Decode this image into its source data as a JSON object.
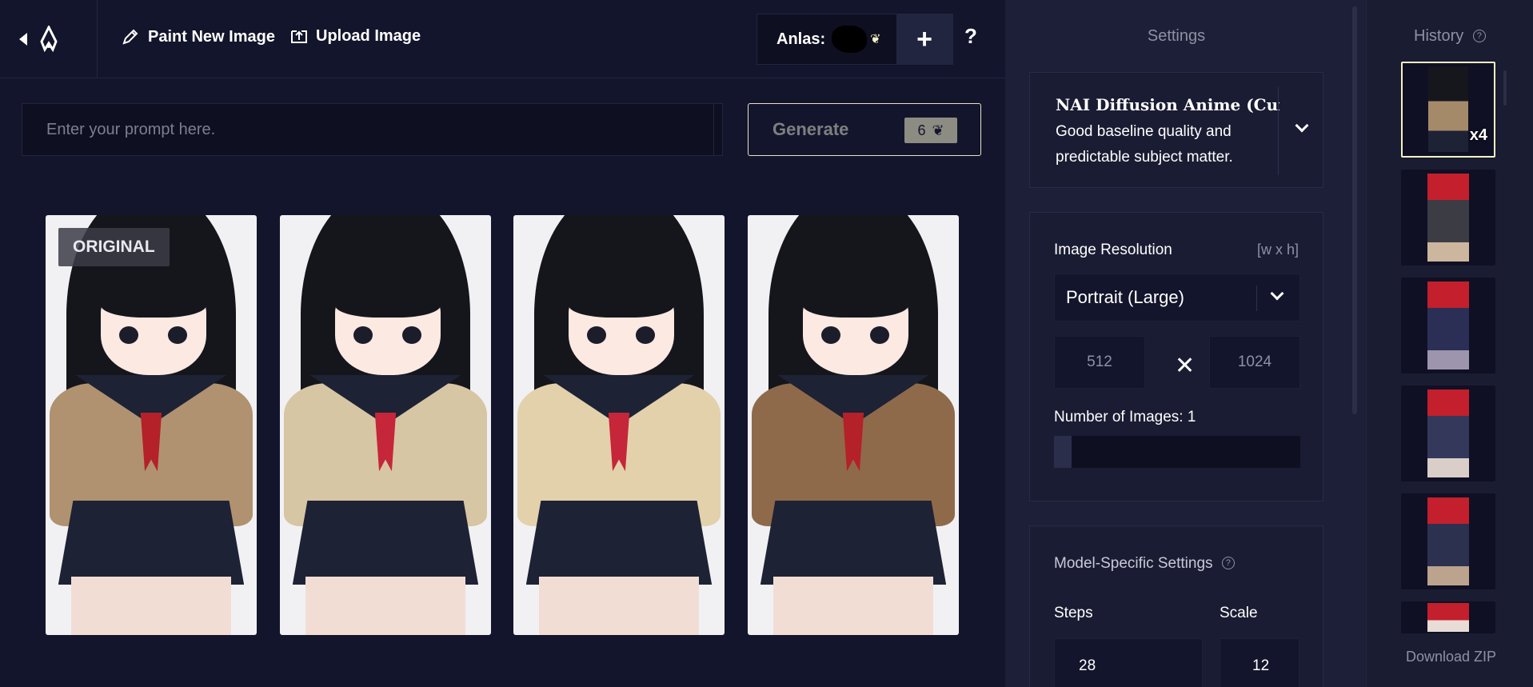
{
  "topbar": {
    "paint_label": "Paint New Image",
    "upload_label": "Upload Image",
    "anlas_label": "Anlas:",
    "plus_label": "+",
    "help_label": "?"
  },
  "prompt": {
    "placeholder": "Enter your prompt here.",
    "value": ""
  },
  "generate": {
    "label": "Generate",
    "cost": "6"
  },
  "images": [
    {
      "badge": "ORIGINAL",
      "hair": "#15161c",
      "accent": "#b42129"
    },
    {
      "badge": "",
      "hair": "#15161c",
      "accent": "#c5263a"
    },
    {
      "badge": "",
      "hair": "#15161c",
      "accent": "#c5263a"
    },
    {
      "badge": "",
      "hair": "#15161c",
      "accent": "#b42129"
    }
  ],
  "settings": {
    "title": "Settings",
    "model": {
      "name": "NAI Diffusion Anime (Curate",
      "description": "Good baseline quality and predictable subject matter."
    },
    "resolution": {
      "label": "Image Resolution",
      "hint": "[w x h]",
      "selected": "Portrait (Large)",
      "width": "512",
      "height": "1024"
    },
    "num_images": {
      "label": "Number of Images:",
      "value": "1",
      "fraction": 0.07
    },
    "model_specific": {
      "label": "Model-Specific Settings",
      "steps_label": "Steps",
      "steps_value": "28",
      "scale_label": "Scale",
      "scale_value": "12"
    }
  },
  "history": {
    "title": "History",
    "items": [
      {
        "count": "x4",
        "hair": "#16171d"
      },
      {
        "count": "",
        "hair": "#c41f2c"
      },
      {
        "count": "",
        "hair": "#c41f2c"
      },
      {
        "count": "",
        "hair": "#c41f2c"
      },
      {
        "count": "",
        "hair": "#c41f2c"
      },
      {
        "count": "",
        "hair": "#c41f2c"
      }
    ],
    "download_label": "Download ZIP"
  },
  "colors": {
    "background": "#13152c",
    "panel": "#1c1f37",
    "accent": "#f5f3c2"
  }
}
